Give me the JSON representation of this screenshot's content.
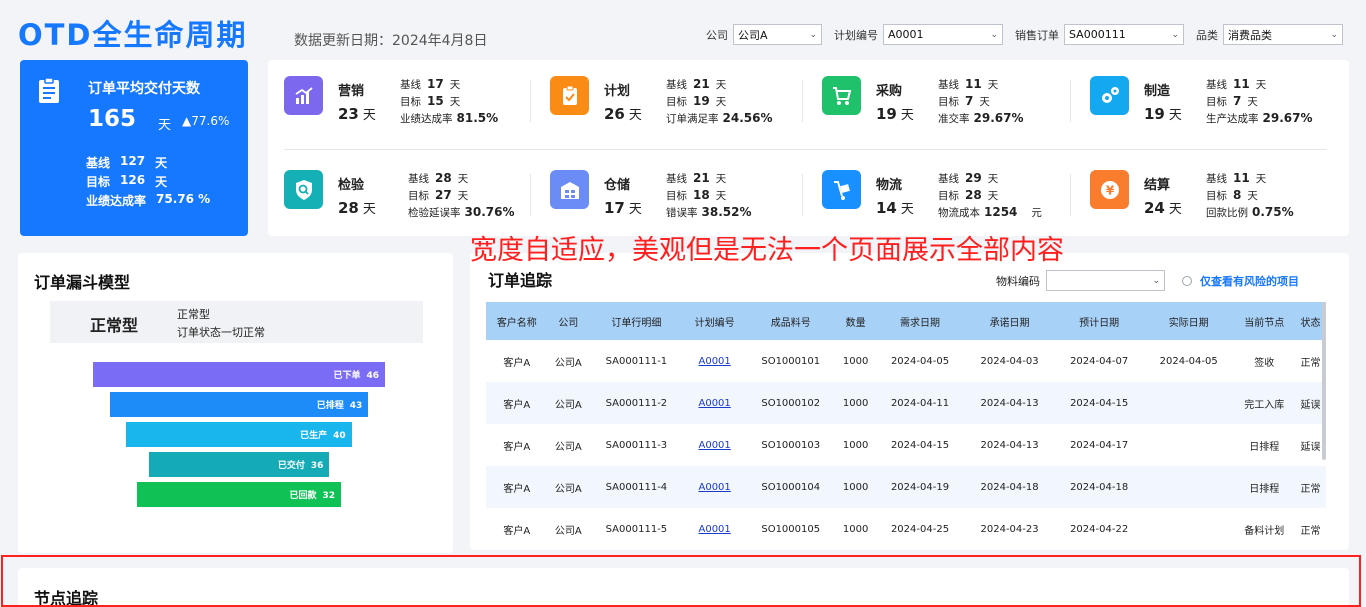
{
  "header": {
    "title": "OTD全生命周期",
    "update_text": "数据更新日期：2024年4月8日"
  },
  "filters": [
    {
      "label": "公司",
      "value": "公司A"
    },
    {
      "label": "计划编号",
      "value": "A0001"
    },
    {
      "label": "销售订单",
      "value": "SA000111"
    },
    {
      "label": "品类",
      "value": "消费品类"
    }
  ],
  "summary": {
    "title": "订单平均交付天数",
    "value": "165",
    "unit": "天",
    "change": "▲77.6%",
    "baseline_label": "基线",
    "baseline": "127",
    "baseline_unit": "天",
    "target_label": "目标",
    "target": "126",
    "target_unit": "天",
    "rate_label": "业绩达成率",
    "rate": "75.76 %"
  },
  "kpis": [
    {
      "name": "营销",
      "value": "23",
      "unit": "天",
      "baseline_label": "基线",
      "baseline": "17",
      "target_label": "目标",
      "target": "15",
      "metric_label": "业绩达成率",
      "metric": "81.5%",
      "icon": "chart-icon",
      "color": "#7b68ee"
    },
    {
      "name": "计划",
      "value": "26",
      "unit": "天",
      "baseline_label": "基线",
      "baseline": "21",
      "target_label": "目标",
      "target": "19",
      "metric_label": "订单满足率",
      "metric": "24.56%",
      "icon": "clipboard-check-icon",
      "color": "#fa8c16"
    },
    {
      "name": "采购",
      "value": "19",
      "unit": "天",
      "baseline_label": "基线",
      "baseline": "11",
      "target_label": "目标",
      "target": "7",
      "metric_label": "准交率",
      "metric": "29.67%",
      "icon": "cart-icon",
      "color": "#1fc26b"
    },
    {
      "name": "制造",
      "value": "19",
      "unit": "天",
      "baseline_label": "基线",
      "baseline": "11",
      "target_label": "目标",
      "target": "7",
      "metric_label": "生产达成率",
      "metric": "29.67%",
      "icon": "gears-icon",
      "color": "#13a8f0"
    },
    {
      "name": "检验",
      "value": "28",
      "unit": "天",
      "baseline_label": "基线",
      "baseline": "28",
      "target_label": "目标",
      "target": "27",
      "metric_label": "检验延误率",
      "metric": "30.76%",
      "icon": "shield-search-icon",
      "color": "#15b0b5"
    },
    {
      "name": "仓储",
      "value": "17",
      "unit": "天",
      "baseline_label": "基线",
      "baseline": "21",
      "target_label": "目标",
      "target": "18",
      "metric_label": "错误率",
      "metric": "38.52%",
      "icon": "warehouse-icon",
      "color": "#6c8cf5"
    },
    {
      "name": "物流",
      "value": "14",
      "unit": "天",
      "baseline_label": "基线",
      "baseline": "29",
      "target_label": "目标",
      "target": "28",
      "metric_label": "物流成本",
      "metric": "1254",
      "metric_unit": "元",
      "icon": "hand-truck-icon",
      "color": "#1890ff"
    },
    {
      "name": "结算",
      "value": "24",
      "unit": "天",
      "baseline_label": "基线",
      "baseline": "11",
      "target_label": "目标",
      "target": "8",
      "metric_label": "回款比例",
      "metric": "0.75%",
      "icon": "yen-coin-icon",
      "color": "#fa7c2d"
    }
  ],
  "kpi_day_unit": "天",
  "funnel": {
    "title": "订单漏斗模型",
    "status": "正常型",
    "status_label": "正常型",
    "status_desc": "订单状态一切正常",
    "stages": [
      {
        "label": "已下单",
        "value": 46,
        "color": "#7b6cf6"
      },
      {
        "label": "已排程",
        "value": 43,
        "color": "#1d8cf8"
      },
      {
        "label": "已生产",
        "value": 40,
        "color": "#19b6ee"
      },
      {
        "label": "已交付",
        "value": 36,
        "color": "#14aab6"
      },
      {
        "label": "已回款",
        "value": 32,
        "color": "#10c255"
      }
    ]
  },
  "tracking": {
    "title": "订单追踪",
    "material_label": "物料编码",
    "material_value": "",
    "risk_label": "仅查看有风险的项目",
    "columns": [
      "客户名称",
      "公司",
      "订单行明细",
      "计划编号",
      "成品料号",
      "数量",
      "需求日期",
      "承诺日期",
      "预计日期",
      "实际日期",
      "当前节点",
      "状态"
    ],
    "rows": [
      [
        "客户A",
        "公司A",
        "SA000111-1",
        "A0001",
        "SO1000101",
        "1000",
        "2024-04-05",
        "2024-04-03",
        "2024-04-07",
        "2024-04-05",
        "签收",
        "正常"
      ],
      [
        "客户A",
        "公司A",
        "SA000111-2",
        "A0001",
        "SO1000102",
        "1000",
        "2024-04-11",
        "2024-04-13",
        "2024-04-15",
        "",
        "完工入库",
        "延误"
      ],
      [
        "客户A",
        "公司A",
        "SA000111-3",
        "A0001",
        "SO1000103",
        "1000",
        "2024-04-15",
        "2024-04-13",
        "2024-04-17",
        "",
        "日排程",
        "延误"
      ],
      [
        "客户A",
        "公司A",
        "SA000111-4",
        "A0001",
        "SO1000104",
        "1000",
        "2024-04-19",
        "2024-04-18",
        "2024-04-18",
        "",
        "日排程",
        "正常"
      ],
      [
        "客户A",
        "公司A",
        "SA000111-5",
        "A0001",
        "SO1000105",
        "1000",
        "2024-04-25",
        "2024-04-23",
        "2024-04-22",
        "",
        "备料计划",
        "正常"
      ]
    ]
  },
  "annotation": "宽度自适应，美观但是无法一个页面展示全部内容",
  "node_tracking": {
    "title": "节点追踪"
  }
}
